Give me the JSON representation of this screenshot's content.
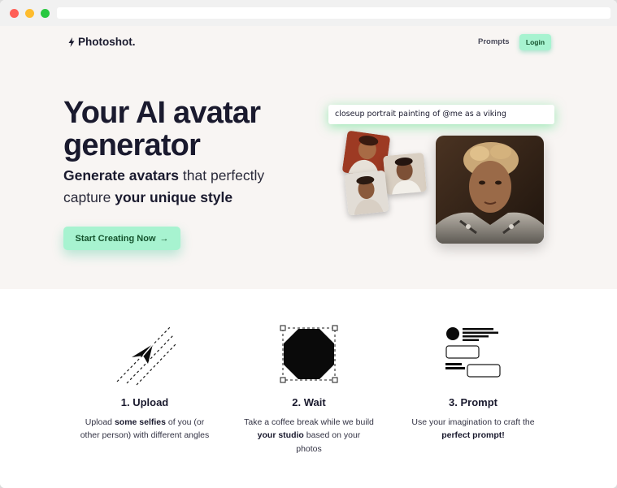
{
  "window": {
    "controls": [
      "close",
      "minimize",
      "maximize"
    ]
  },
  "nav": {
    "brand": "Photoshot.",
    "brand_icon": "lightning-bolt-icon",
    "links": {
      "prompts": "Prompts",
      "login": "Login"
    }
  },
  "hero": {
    "title_line1": "Your AI avatar",
    "title_line2": "generator",
    "subtitle": {
      "part1_bold": "Generate avatars",
      "part2": " that perfectly",
      "part3": "capture ",
      "part4_bold": "your unique style"
    },
    "cta_label": "Start Creating Now",
    "cta_icon": "arrow-right-icon",
    "prompt_example": "closeup portrait painting of @me as a viking"
  },
  "steps": [
    {
      "icon": "paper-plane-icon",
      "title": "1. Upload",
      "desc": {
        "a": "Upload ",
        "b_bold": "some selfies",
        "c": " of you (or other person) with different angles"
      }
    },
    {
      "icon": "octagon-selection-icon",
      "title": "2. Wait",
      "desc": {
        "a": "Take a coffee break while we build ",
        "b_bold": "your studio",
        "c": " based on your photos"
      }
    },
    {
      "icon": "prompt-layout-icon",
      "title": "3. Prompt",
      "desc": {
        "a": "Use your imagination to craft the ",
        "b_bold": "perfect prompt!",
        "c": ""
      }
    }
  ],
  "colors": {
    "accent": "#a7f3d0",
    "accent_text": "#14532d",
    "hero_bg": "#f8f5f3",
    "text": "#1a1a2e"
  }
}
